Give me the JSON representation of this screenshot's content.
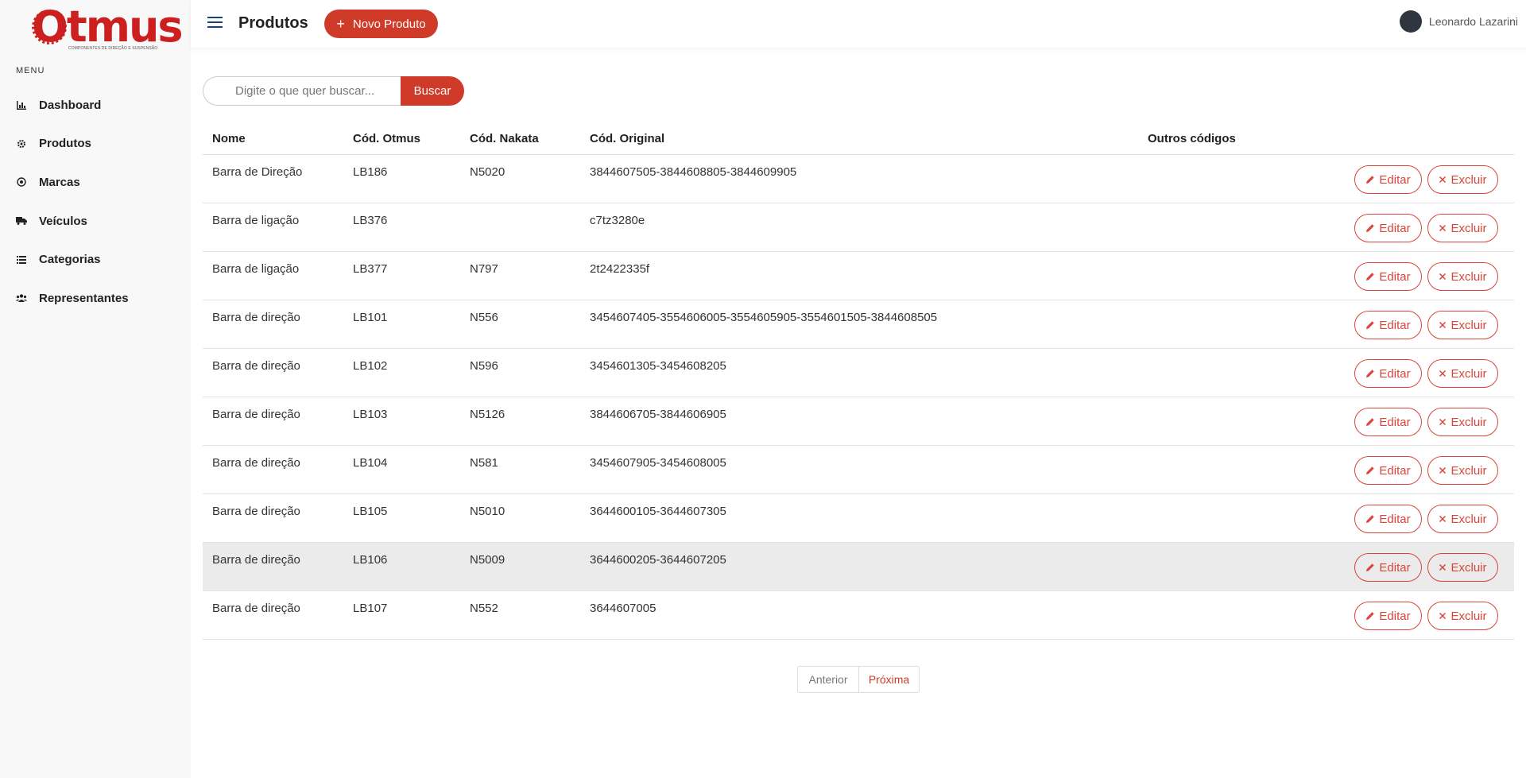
{
  "brand": {
    "name": "Otmus",
    "tagline": "COMPONENTES DE DIREÇÃO E SUSPENSÃO",
    "color": "#cc1f1f"
  },
  "sidebar": {
    "menu_title": "MENU",
    "items": [
      {
        "label": "Dashboard",
        "icon": "bar-chart-icon"
      },
      {
        "label": "Produtos",
        "icon": "gear-icon"
      },
      {
        "label": "Marcas",
        "icon": "target-icon"
      },
      {
        "label": "Veículos",
        "icon": "truck-icon"
      },
      {
        "label": "Categorias",
        "icon": "list-icon"
      },
      {
        "label": "Representantes",
        "icon": "users-icon"
      }
    ]
  },
  "header": {
    "title": "Produtos",
    "new_button": "Novo Produto",
    "user_name": "Leonardo Lazarini"
  },
  "search": {
    "placeholder": "Digite o que quer buscar...",
    "button": "Buscar"
  },
  "table": {
    "columns": [
      "Nome",
      "Cód. Otmus",
      "Cód. Nakata",
      "Cód. Original",
      "Outros códigos"
    ],
    "edit_label": "Editar",
    "delete_label": "Excluir",
    "rows": [
      {
        "nome": "Barra de Direção",
        "otmus": "LB186",
        "nakata": "N5020",
        "original": "3844607505-3844608805-3844609905",
        "outros": ""
      },
      {
        "nome": "Barra de ligação",
        "otmus": "LB376",
        "nakata": "",
        "original": "c7tz3280e",
        "outros": ""
      },
      {
        "nome": "Barra de ligação",
        "otmus": "LB377",
        "nakata": "N797",
        "original": "2t2422335f",
        "outros": ""
      },
      {
        "nome": "Barra de direção",
        "otmus": "LB101",
        "nakata": "N556",
        "original": "3454607405-3554606005-3554605905-3554601505-3844608505",
        "outros": ""
      },
      {
        "nome": "Barra de direção",
        "otmus": "LB102",
        "nakata": "N596",
        "original": "3454601305-3454608205",
        "outros": ""
      },
      {
        "nome": "Barra de direção",
        "otmus": "LB103",
        "nakata": "N5126",
        "original": "3844606705-3844606905",
        "outros": ""
      },
      {
        "nome": "Barra de direção",
        "otmus": "LB104",
        "nakata": "N581",
        "original": "3454607905-3454608005",
        "outros": ""
      },
      {
        "nome": "Barra de direção",
        "otmus": "LB105",
        "nakata": "N5010",
        "original": "3644600105-3644607305",
        "outros": ""
      },
      {
        "nome": "Barra de direção",
        "otmus": "LB106",
        "nakata": "N5009",
        "original": "3644600205-3644607205",
        "outros": ""
      },
      {
        "nome": "Barra de direção",
        "otmus": "LB107",
        "nakata": "N552",
        "original": "3644607005",
        "outros": ""
      }
    ]
  },
  "pagination": {
    "prev": "Anterior",
    "next": "Próxima"
  },
  "colors": {
    "accent": "#cf3b28",
    "danger_outline": "#d9453a",
    "hamburger": "#1b3f84"
  }
}
